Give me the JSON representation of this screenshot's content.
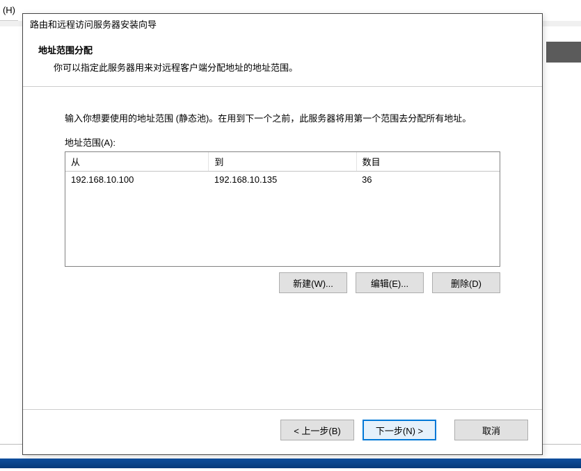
{
  "menu_fragment": "(H)",
  "wizard": {
    "title": "路由和远程访问服务器安装向导",
    "header": {
      "heading": "地址范围分配",
      "subtext": "你可以指定此服务器用来对远程客户端分配地址的地址范围。"
    },
    "body": {
      "instruction": "输入你想要使用的地址范围 (静态池)。在用到下一个之前，此服务器将用第一个范围去分配所有地址。",
      "list_label": "地址范围(A):",
      "columns": {
        "from": "从",
        "to": "到",
        "count": "数目"
      },
      "rows": [
        {
          "from": "192.168.10.100",
          "to": "192.168.10.135",
          "count": "36"
        }
      ],
      "buttons": {
        "new": "新建(W)...",
        "edit": "编辑(E)...",
        "delete": "删除(D)"
      }
    },
    "footer": {
      "back": "< 上一步(B)",
      "next": "下一步(N) >",
      "cancel": "取消"
    }
  }
}
